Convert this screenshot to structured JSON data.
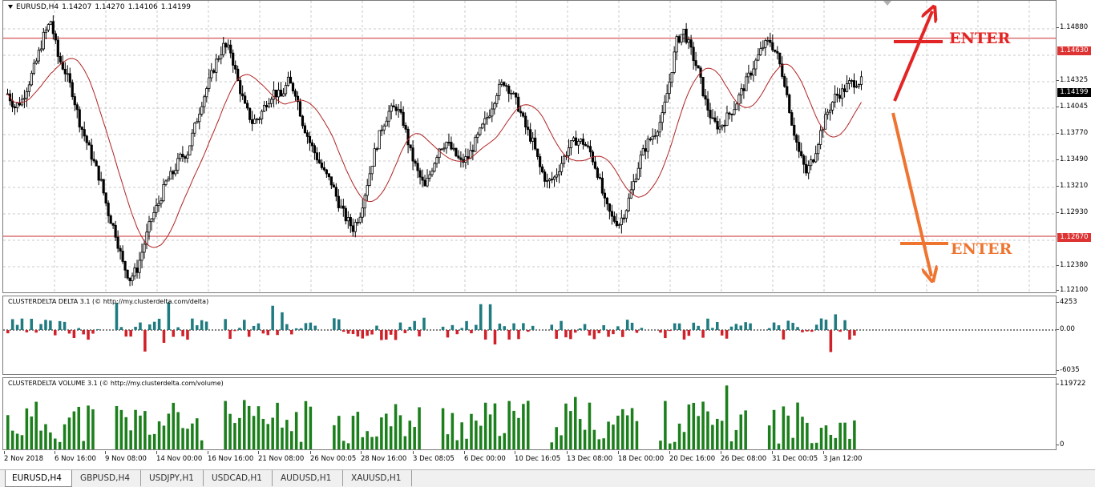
{
  "chart_header": {
    "symbol": "EURUSD,H4",
    "open": "1.14207",
    "high": "1.14270",
    "low": "1.14106",
    "close": "1.14199"
  },
  "price_axis": {
    "ticks": [
      "1.14880",
      "1.14325",
      "1.14045",
      "1.13770",
      "1.13490",
      "1.13210",
      "1.12930",
      "1.12380",
      "1.12100"
    ],
    "upper_level_tag": "1.14630",
    "lower_level_tag": "1.12670",
    "current_price_tag": "1.14199"
  },
  "delta_indicator": {
    "title": "CLUSTERDELTA DELTA 3.1 (© http://my.clusterdelta.com/delta)",
    "ticks": [
      "4253",
      "0.00",
      "-6035"
    ],
    "colors": {
      "positive": "#1f7b80",
      "negative": "#d0202a"
    }
  },
  "volume_indicator": {
    "title": "CLUSTERDELTA VOLUME 3.1 (© http://my.clusterdelta.com/volume)",
    "ticks": [
      "119722",
      "0"
    ],
    "color": "#1b7f1b"
  },
  "time_axis": {
    "ticks": [
      "2 Nov 2018",
      "6 Nov 16:00",
      "9 Nov 08:00",
      "14 Nov 00:00",
      "16 Nov 16:00",
      "21 Nov 08:00",
      "26 Nov 00:05",
      "28 Nov 16:00",
      "3 Dec 08:05",
      "6 Dec 00:00",
      "10 Dec 16:05",
      "13 Dec 08:00",
      "18 Dec 00:00",
      "20 Dec 16:00",
      "26 Dec 08:00",
      "31 Dec 00:05",
      "3 Jan 12:00"
    ]
  },
  "annotations": {
    "enter_up": "ENTER",
    "enter_down": "ENTER",
    "colors": {
      "up": "#e32424",
      "down": "#ee7430"
    }
  },
  "tabs": [
    {
      "label": "EURUSD,H4",
      "active": true
    },
    {
      "label": "GBPUSD,H4",
      "active": false
    },
    {
      "label": "USDJPY,H1",
      "active": false
    },
    {
      "label": "USDCAD,H1",
      "active": false
    },
    {
      "label": "AUDUSD,H1",
      "active": false
    },
    {
      "label": "XAUUSD,H1",
      "active": false
    }
  ],
  "chart_data": {
    "type": "candlestick",
    "symbol": "EURUSD",
    "timeframe": "H4",
    "ylim": [
      1.121,
      1.15
    ],
    "horizontal_levels": [
      1.1463,
      1.1267
    ],
    "moving_average": {
      "color": "#b22222"
    },
    "grid": true,
    "close_series": [
      1.1408,
      1.1395,
      1.1402,
      1.142,
      1.144,
      1.1465,
      1.148,
      1.1445,
      1.143,
      1.141,
      1.138,
      1.136,
      1.134,
      1.132,
      1.129,
      1.127,
      1.124,
      1.1225,
      1.1235,
      1.126,
      1.1285,
      1.13,
      1.132,
      1.133,
      1.1345,
      1.135,
      1.1375,
      1.14,
      1.142,
      1.144,
      1.1455,
      1.145,
      1.142,
      1.1395,
      1.138,
      1.1385,
      1.14,
      1.141,
      1.1405,
      1.142,
      1.141,
      1.138,
      1.136,
      1.1345,
      1.133,
      1.132,
      1.13,
      1.1285,
      1.1275,
      1.129,
      1.132,
      1.135,
      1.1375,
      1.139,
      1.1395,
      1.138,
      1.135,
      1.133,
      1.1315,
      1.1335,
      1.1355,
      1.136,
      1.135,
      1.134,
      1.1345,
      1.136,
      1.1375,
      1.139,
      1.141,
      1.142,
      1.141,
      1.1395,
      1.1375,
      1.136,
      1.1335,
      1.132,
      1.1325,
      1.134,
      1.1355,
      1.1362,
      1.136,
      1.135,
      1.133,
      1.13,
      1.1285,
      1.128,
      1.1295,
      1.132,
      1.1345,
      1.136,
      1.137,
      1.1385,
      1.142,
      1.146,
      1.147,
      1.145,
      1.143,
      1.14,
      1.138,
      1.1375,
      1.1385,
      1.1395,
      1.141,
      1.1425,
      1.144,
      1.1455,
      1.146,
      1.1445,
      1.142,
      1.138,
      1.135,
      1.133,
      1.1345,
      1.137,
      1.139,
      1.1405,
      1.141,
      1.1418,
      1.142
    ]
  }
}
